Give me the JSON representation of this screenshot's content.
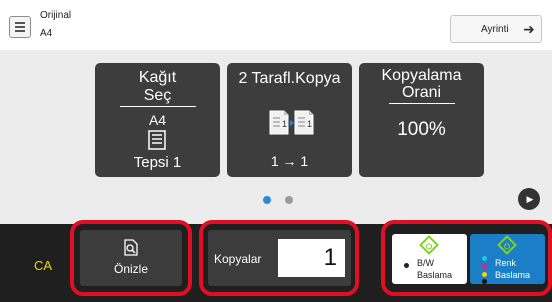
{
  "header": {
    "original_label": "Orijinal",
    "original_size": "A4",
    "detail_label": "Ayrinti"
  },
  "tiles": {
    "paper": {
      "title_line1": "Kağıt",
      "title_line2": "Seç",
      "size": "A4",
      "tray": "Tepsi 1"
    },
    "duplex": {
      "title": "2 Tarafl.Kopya",
      "mode": "1 → 1"
    },
    "ratio": {
      "title_line1": "Kopyalama",
      "title_line2": "Orani",
      "value": "100%"
    }
  },
  "pager": {
    "pages": 2,
    "active_page": 1
  },
  "bottom": {
    "ca_label": "CA",
    "preview_label": "Önizle",
    "copies_label": "Kopyalar",
    "copies_value": "1",
    "bw_start": {
      "line1": "B/W",
      "line2": "Baslama"
    },
    "color_start": {
      "line1": "Renk",
      "line2": "Baslama"
    }
  },
  "colors": {
    "highlight_frame": "#e20f24",
    "tile_bg": "#3d3d3d",
    "ca_text": "#f5d800",
    "color_start_bg": "#1a7fc6",
    "start_icon": "#7ed321",
    "active_dot": "#2f86d6"
  },
  "icons": [
    "original-document-icon",
    "arrow-right-icon",
    "paper-tray-icon",
    "duplex-copy-icon",
    "next-page-icon",
    "preview-icon",
    "start-diamond-icon"
  ]
}
